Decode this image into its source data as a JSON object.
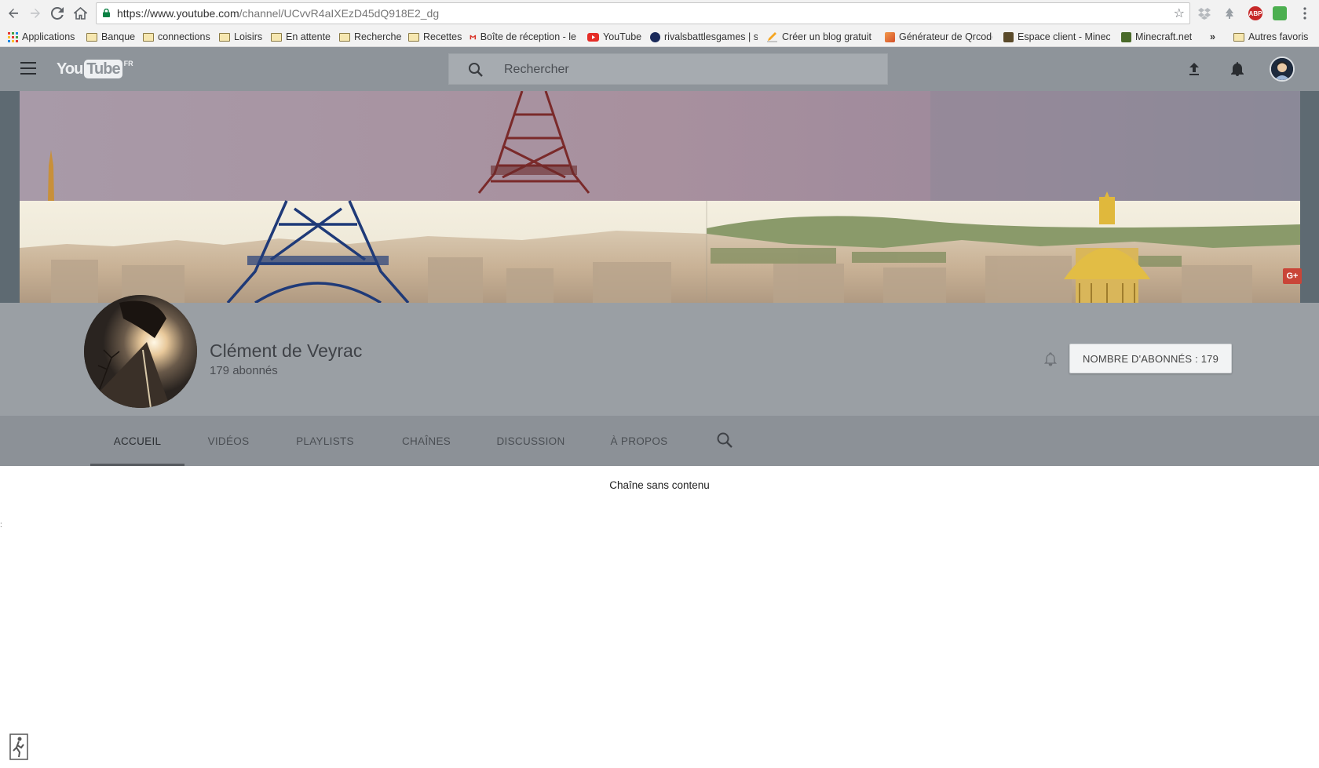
{
  "browser": {
    "url_domain": "https://www.youtube.com",
    "url_path": "/channel/UCvvR4aIXEzD45dQ918E2_dg",
    "bookmarks": [
      {
        "label": "Applications",
        "icon": "apps-grid-icon"
      },
      {
        "label": "Banque",
        "icon": "folder-icon"
      },
      {
        "label": "connections",
        "icon": "folder-icon"
      },
      {
        "label": "Loisirs",
        "icon": "folder-icon"
      },
      {
        "label": "En attente",
        "icon": "folder-icon"
      },
      {
        "label": "Recherche",
        "icon": "folder-icon"
      },
      {
        "label": "Recettes",
        "icon": "folder-icon"
      },
      {
        "label": "Boîte de réception - le",
        "icon": "gmail-icon"
      },
      {
        "label": "YouTube",
        "icon": "youtube-icon"
      },
      {
        "label": "rivalsbattlesgames | si",
        "icon": "site-icon"
      },
      {
        "label": "Créer un blog gratuit",
        "icon": "pencil-icon"
      },
      {
        "label": "Générateur de Qrcode",
        "icon": "qrcode-icon"
      },
      {
        "label": "Espace client - Minecr",
        "icon": "minecraft-icon"
      },
      {
        "label": "Minecraft.net",
        "icon": "minecraft-icon"
      }
    ],
    "overflow": "»",
    "other_bookmarks": "Autres favoris"
  },
  "header": {
    "logo_you": "You",
    "logo_tube": "Tube",
    "logo_region": "FR",
    "search_placeholder": "Rechercher"
  },
  "channel": {
    "name": "Clément de Veyrac",
    "subscribers": "179 abonnés",
    "subscribe_button": "NOMBRE D'ABONNÉS :  179"
  },
  "tabs": [
    {
      "label": "ACCUEIL",
      "active": true
    },
    {
      "label": "VIDÉOS",
      "active": false
    },
    {
      "label": "PLAYLISTS",
      "active": false
    },
    {
      "label": "CHAÎNES",
      "active": false
    },
    {
      "label": "DISCUSSION",
      "active": false
    },
    {
      "label": "À PROPOS",
      "active": false
    }
  ],
  "content": {
    "empty_message": "Chaîne sans contenu"
  },
  "colors": {
    "header_bg": "#8e949a",
    "channel_info_bg": "#9a9fa4",
    "tabs_bg": "#8c9197"
  }
}
